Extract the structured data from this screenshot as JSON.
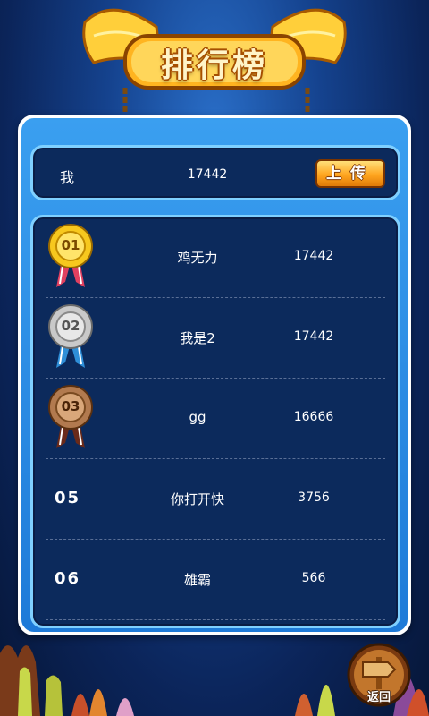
{
  "title": "排行榜",
  "my_entry": {
    "name": "我",
    "score": "17442"
  },
  "upload_button": {
    "label": "上传"
  },
  "leaderboard": [
    {
      "rank": "01",
      "name": "鸡无力",
      "score": "17442",
      "medal": "gold"
    },
    {
      "rank": "02",
      "name": "我是2",
      "score": "17442",
      "medal": "silver"
    },
    {
      "rank": "03",
      "name": "gg",
      "score": "16666",
      "medal": "bronze"
    },
    {
      "rank": "05",
      "name": "你打开快",
      "score": "3756",
      "medal": null
    },
    {
      "rank": "06",
      "name": "雄霸",
      "score": "566",
      "medal": null
    }
  ],
  "back_button": {
    "label": "返回"
  },
  "colors": {
    "panel_border": "#ffffff",
    "panel_fill": "#2a8ee6",
    "inner_fill": "#0c2a5c",
    "inner_border": "#7fd0ff",
    "upload_fill": "#ffa51f",
    "gold": "#f7c81e",
    "silver": "#c9c9c9",
    "bronze": "#b27a4f"
  }
}
